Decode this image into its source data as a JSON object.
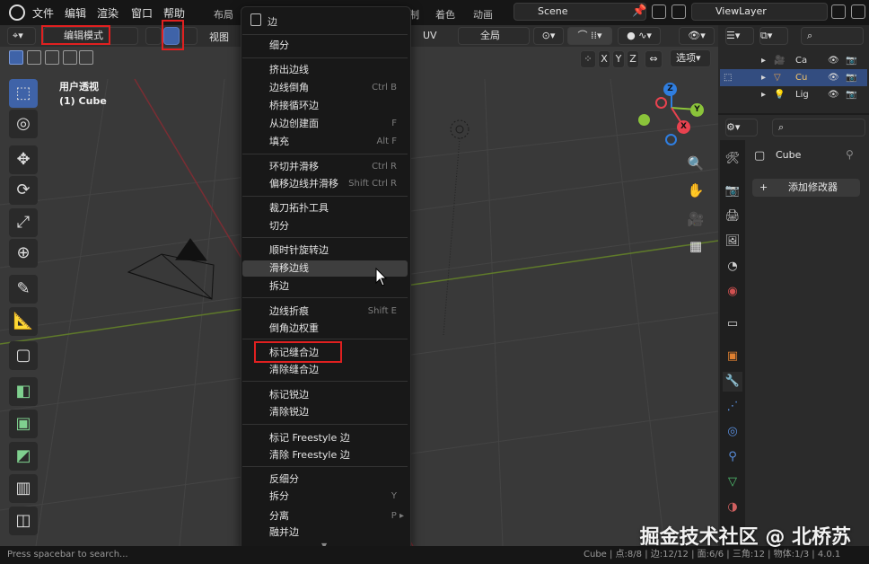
{
  "topbar": {
    "menus": [
      "文件",
      "编辑",
      "渲染",
      "窗口",
      "帮助"
    ],
    "workspace_tabs": [
      "布局",
      "制",
      "着色",
      "动画"
    ],
    "scene": "Scene",
    "view_layer": "ViewLayer"
  },
  "viewport_header": {
    "mode": "编辑模式",
    "view_menu": "视图",
    "uv_menu": "UV",
    "orientation": "全局",
    "axes": [
      "X",
      "Y",
      "Z"
    ],
    "options": "选项"
  },
  "viewport": {
    "view_name": "用户透视",
    "object_name": "(1) Cube",
    "gizmo_axes": [
      "Z",
      "Y",
      "X"
    ]
  },
  "outliner": {
    "items": [
      {
        "label": "Ca",
        "icon": "camera-icon"
      },
      {
        "label": "Cu",
        "icon": "mesh-icon"
      },
      {
        "label": "Lig",
        "icon": "light-icon"
      }
    ]
  },
  "properties": {
    "object_name": "Cube",
    "add_modifier": "添加修改器"
  },
  "menu": {
    "title": "边",
    "items": [
      {
        "label": "细分",
        "shortcut": ""
      },
      {
        "label": "挤出边线",
        "shortcut": ""
      },
      {
        "label": "边线倒角",
        "shortcut": "Ctrl B"
      },
      {
        "label": "桥接循环边",
        "shortcut": ""
      },
      {
        "label": "从边创建面",
        "shortcut": "F"
      },
      {
        "label": "填充",
        "shortcut": "Alt F"
      },
      {
        "label": "环切并滑移",
        "shortcut": "Ctrl R"
      },
      {
        "label": "偏移边线并滑移",
        "shortcut": "Shift Ctrl R"
      },
      {
        "label": "裁刀拓扑工具",
        "shortcut": ""
      },
      {
        "label": "切分",
        "shortcut": ""
      },
      {
        "label": "顺时针旋转边",
        "shortcut": ""
      },
      {
        "label": "滑移边线",
        "shortcut": ""
      },
      {
        "label": "拆边",
        "shortcut": ""
      },
      {
        "label": "边线折痕",
        "shortcut": "Shift E"
      },
      {
        "label": "倒角边权重",
        "shortcut": ""
      },
      {
        "label": "标记缝合边",
        "shortcut": ""
      },
      {
        "label": "清除缝合边",
        "shortcut": ""
      },
      {
        "label": "标记锐边",
        "shortcut": ""
      },
      {
        "label": "清除锐边",
        "shortcut": ""
      },
      {
        "label": "标记 Freestyle 边",
        "shortcut": ""
      },
      {
        "label": "清除 Freestyle 边",
        "shortcut": ""
      },
      {
        "label": "反细分",
        "shortcut": ""
      },
      {
        "label": "拆分",
        "shortcut": "Y"
      },
      {
        "label": "分离",
        "shortcut": "P"
      },
      {
        "label": "融并边",
        "shortcut": ""
      }
    ]
  },
  "status": {
    "hint": "Press spacebar to search...",
    "stats": "Cube | 点:8/8 | 边:12/12 | 面:6/6 | 三角:12 | 物体:1/3 | 4.0.1"
  },
  "watermark": "掘金技术社区 @ 北桥苏",
  "colors": {
    "accent": "#3f63a8",
    "highlight_box": "#e02020",
    "axis_x": "#e8424f",
    "axis_y": "#8bc43a",
    "axis_z": "#2f7ee0"
  }
}
